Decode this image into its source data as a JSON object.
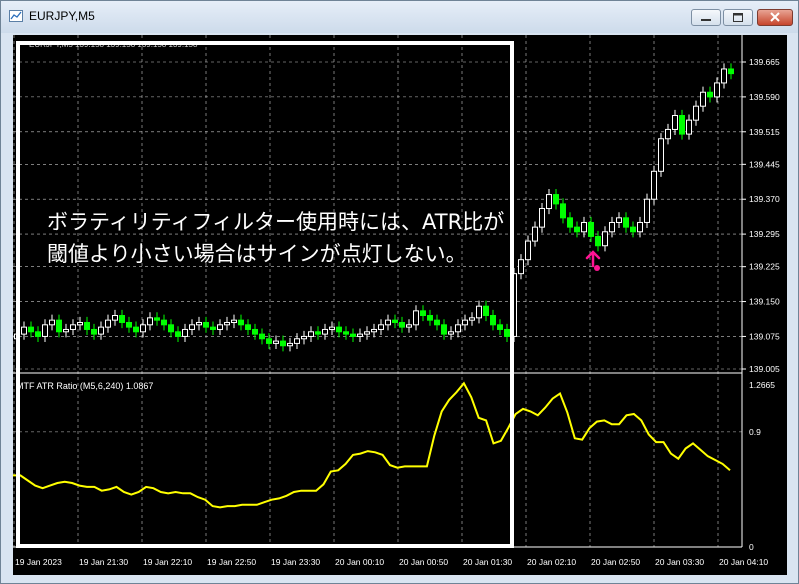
{
  "window": {
    "title": "EURJPY,M5"
  },
  "main_header": "EURJPY,M5 139.158 139.158 139.158 139.158",
  "indicator_header": "MTF ATR Ratio  (M5,6,240) 1.0867",
  "annotation": {
    "line1": "ボラティリティフィルター使用時には、ATR比が",
    "line2": "閾値より小さい場合はサインが点灯しない。"
  },
  "colors": {
    "bull": "#ffffff",
    "bear": "#00ff00",
    "atr_line": "#ffff00",
    "signal": "#ff1493",
    "grid": "#c8c8c8",
    "axis": "#ffffff"
  },
  "chart_data": [
    {
      "type": "candlestick",
      "symbol": "EURJPY",
      "timeframe": "M5",
      "y_ticks": [
        "139.665",
        "139.590",
        "139.515",
        "139.445",
        "139.370",
        "139.295",
        "139.225",
        "139.150",
        "139.075",
        "139.005"
      ],
      "ylim": [
        139.005,
        139.705
      ],
      "x_ticks": [
        "19 Jan 2023",
        "19 Jan 21:30",
        "19 Jan 22:10",
        "19 Jan 22:50",
        "19 Jan 23:30",
        "20 Jan 00:10",
        "20 Jan 00:50",
        "20 Jan 01:30",
        "20 Jan 02:10",
        "20 Jan 02:50",
        "20 Jan 03:30",
        "20 Jan 04:10"
      ],
      "close": [
        139.08,
        139.095,
        139.085,
        139.075,
        139.1,
        139.11,
        139.085,
        139.09,
        139.1,
        139.105,
        139.09,
        139.08,
        139.095,
        139.11,
        139.12,
        139.105,
        139.095,
        139.085,
        139.1,
        139.115,
        139.11,
        139.1,
        139.085,
        139.075,
        139.09,
        139.1,
        139.105,
        139.095,
        139.09,
        139.1,
        139.105,
        139.11,
        139.1,
        139.09,
        139.08,
        139.07,
        139.06,
        139.065,
        139.055,
        139.06,
        139.07,
        139.075,
        139.085,
        139.08,
        139.09,
        139.095,
        139.085,
        139.08,
        139.075,
        139.08,
        139.085,
        139.09,
        139.1,
        139.11,
        139.105,
        139.095,
        139.1,
        139.13,
        139.12,
        139.11,
        139.1,
        139.08,
        139.085,
        139.1,
        139.11,
        139.115,
        139.14,
        139.12,
        139.1,
        139.09,
        139.075,
        139.21,
        139.24,
        139.28,
        139.31,
        139.35,
        139.38,
        139.36,
        139.33,
        139.31,
        139.3,
        139.32,
        139.29,
        139.27,
        139.3,
        139.32,
        139.33,
        139.31,
        139.3,
        139.32,
        139.37,
        139.43,
        139.5,
        139.52,
        139.55,
        139.51,
        139.54,
        139.57,
        139.6,
        139.59,
        139.62,
        139.65,
        139.64
      ]
    },
    {
      "type": "line",
      "name": "MTF ATR Ratio",
      "y_ticks": [
        "1.2665",
        "0.9",
        "0"
      ],
      "ylim": [
        0,
        1.2665
      ],
      "values": [
        0.56,
        0.56,
        0.52,
        0.48,
        0.46,
        0.48,
        0.5,
        0.51,
        0.5,
        0.48,
        0.47,
        0.47,
        0.44,
        0.45,
        0.47,
        0.43,
        0.41,
        0.43,
        0.47,
        0.46,
        0.43,
        0.42,
        0.43,
        0.42,
        0.42,
        0.39,
        0.37,
        0.32,
        0.31,
        0.32,
        0.32,
        0.33,
        0.33,
        0.33,
        0.35,
        0.37,
        0.38,
        0.4,
        0.43,
        0.44,
        0.44,
        0.44,
        0.49,
        0.59,
        0.6,
        0.65,
        0.72,
        0.73,
        0.75,
        0.74,
        0.72,
        0.64,
        0.62,
        0.63,
        0.63,
        0.63,
        0.63,
        0.87,
        1.06,
        1.15,
        1.21,
        1.28,
        1.17,
        1.01,
        0.99,
        0.81,
        0.83,
        0.93,
        1.04,
        1.08,
        1.06,
        1.03,
        1.09,
        1.16,
        1.2,
        1.05,
        0.85,
        0.84,
        0.93,
        0.98,
        0.99,
        0.96,
        0.96,
        1.03,
        1.04,
        0.99,
        0.88,
        0.82,
        0.82,
        0.73,
        0.69,
        0.77,
        0.81,
        0.76,
        0.71,
        0.68,
        0.65,
        0.6
      ]
    }
  ]
}
